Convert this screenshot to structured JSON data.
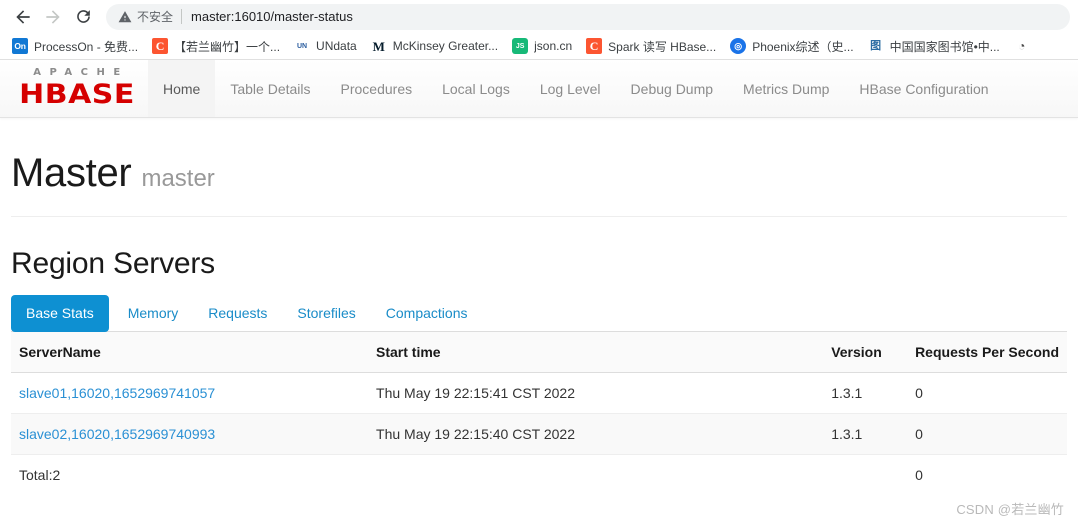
{
  "browser": {
    "nav": {
      "back_icon": "arrow-left-icon",
      "forward_icon": "arrow-right-icon",
      "reload_icon": "reload-icon"
    },
    "omnibox": {
      "security_icon": "warning-triangle-icon",
      "security_label": "不安全",
      "url": "master:16010/master-status"
    },
    "bookmarks": [
      {
        "icon": "processon-icon",
        "icon_text": "On",
        "label": "ProcessOn - 免费..."
      },
      {
        "icon": "csdn-icon",
        "icon_text": "C",
        "label": "【若兰幽竹】一个..."
      },
      {
        "icon": "undata-icon",
        "icon_text": "UN",
        "label": "UNdata"
      },
      {
        "icon": "mckinsey-icon",
        "icon_text": "M",
        "label": "McKinsey Greater..."
      },
      {
        "icon": "json-icon",
        "icon_text": "JS",
        "label": "json.cn"
      },
      {
        "icon": "csdn-icon",
        "icon_text": "C",
        "label": "Spark 读写 HBase..."
      },
      {
        "icon": "phoenix-icon",
        "icon_text": "◎",
        "label": "Phoenix综述（史..."
      },
      {
        "icon": "nlc-icon",
        "icon_text": "图",
        "label": "中国国家图书馆•中..."
      },
      {
        "icon": "globe-icon",
        "icon_text": "◔",
        "label": ""
      }
    ]
  },
  "hbase": {
    "brand": {
      "apache": "APACHE",
      "hbase": "HBASE"
    },
    "nav_items": [
      {
        "label": "Home",
        "active": true
      },
      {
        "label": "Table Details",
        "active": false
      },
      {
        "label": "Procedures",
        "active": false
      },
      {
        "label": "Local Logs",
        "active": false
      },
      {
        "label": "Log Level",
        "active": false
      },
      {
        "label": "Debug Dump",
        "active": false
      },
      {
        "label": "Metrics Dump",
        "active": false
      },
      {
        "label": "HBase Configuration",
        "active": false
      }
    ],
    "page": {
      "title": "Master",
      "subtitle": "master",
      "section_title": "Region Servers"
    },
    "tabs": [
      {
        "label": "Base Stats",
        "active": true
      },
      {
        "label": "Memory",
        "active": false
      },
      {
        "label": "Requests",
        "active": false
      },
      {
        "label": "Storefiles",
        "active": false
      },
      {
        "label": "Compactions",
        "active": false
      }
    ],
    "table": {
      "columns": [
        "ServerName",
        "Start time",
        "Version",
        "Requests Per Second"
      ],
      "rows": [
        {
          "server_name": "slave01,16020,1652969741057",
          "start_time": "Thu May 19 22:15:41 CST 2022",
          "version": "1.3.1",
          "requests_per_second": "0"
        },
        {
          "server_name": "slave02,16020,1652969740993",
          "start_time": "Thu May 19 22:15:40 CST 2022",
          "version": "1.3.1",
          "requests_per_second": "0"
        }
      ],
      "footer": {
        "total": "Total:2",
        "start_time": "",
        "version": "",
        "requests_per_second": "0"
      }
    },
    "colors": {
      "accent_blue": "#0e90d2",
      "link_blue": "#2a90d4",
      "brand_red": "#d50000"
    }
  },
  "watermark": "CSDN @若兰幽竹"
}
